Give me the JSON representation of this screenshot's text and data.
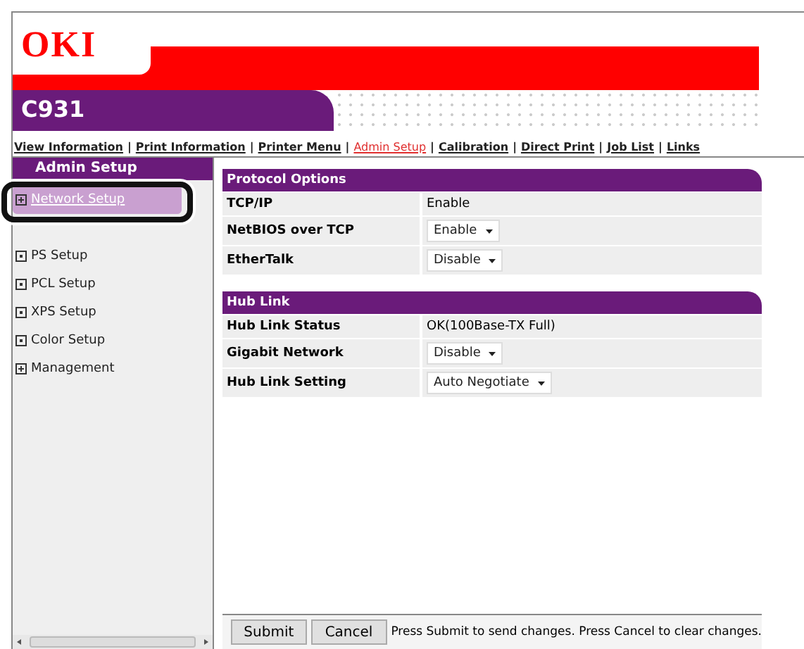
{
  "header": {
    "logo": "OKI",
    "model": "C931"
  },
  "nav": [
    {
      "kind": "link",
      "label": "View Information",
      "selected": false
    },
    {
      "kind": "separator",
      "label": "|"
    },
    {
      "kind": "link",
      "label": "Print Information",
      "selected": false
    },
    {
      "kind": "separator",
      "label": "|"
    },
    {
      "kind": "link",
      "label": "Printer Menu",
      "selected": false
    },
    {
      "kind": "separator",
      "label": "|"
    },
    {
      "kind": "link",
      "label": "Admin Setup",
      "selected": true
    },
    {
      "kind": "separator",
      "label": "|"
    },
    {
      "kind": "link",
      "label": "Calibration",
      "selected": false
    },
    {
      "kind": "separator",
      "label": "|"
    },
    {
      "kind": "link",
      "label": "Direct Print",
      "selected": false
    },
    {
      "kind": "separator",
      "label": "|"
    },
    {
      "kind": "link",
      "label": "Job List",
      "selected": false
    },
    {
      "kind": "separator",
      "label": "|"
    },
    {
      "kind": "link",
      "label": "Links",
      "selected": false
    }
  ],
  "sidebar": {
    "title": "Admin Setup",
    "items": [
      {
        "label": "Network Setup",
        "kind": "group",
        "selected": true
      },
      {
        "kind": "covered"
      },
      {
        "label": "PS Setup",
        "kind": "page",
        "selected": false
      },
      {
        "label": "PCL Setup",
        "kind": "page",
        "selected": false
      },
      {
        "label": "XPS Setup",
        "kind": "page",
        "selected": false
      },
      {
        "label": "Color Setup",
        "kind": "page",
        "selected": false
      },
      {
        "label": "Management",
        "kind": "group",
        "selected": false
      }
    ]
  },
  "sections": [
    {
      "title": "Protocol Options",
      "rows": [
        {
          "label": "TCP/IP",
          "kind": "text",
          "value": "Enable"
        },
        {
          "label": "NetBIOS over TCP",
          "kind": "select",
          "value": "Enable"
        },
        {
          "label": "EtherTalk",
          "kind": "select",
          "value": "Disable"
        }
      ]
    },
    {
      "title": "Hub Link",
      "rows": [
        {
          "label": "Hub Link Status",
          "kind": "text",
          "value": "OK(100Base-TX Full)"
        },
        {
          "label": "Gigabit Network",
          "kind": "select",
          "value": "Disable"
        },
        {
          "label": "Hub Link Setting",
          "kind": "select",
          "value": "Auto Negotiate"
        }
      ]
    }
  ],
  "footer": {
    "buttons": [
      "Submit",
      "Cancel"
    ],
    "hint": "Press Submit to send changes. Press Cancel to clear changes."
  }
}
